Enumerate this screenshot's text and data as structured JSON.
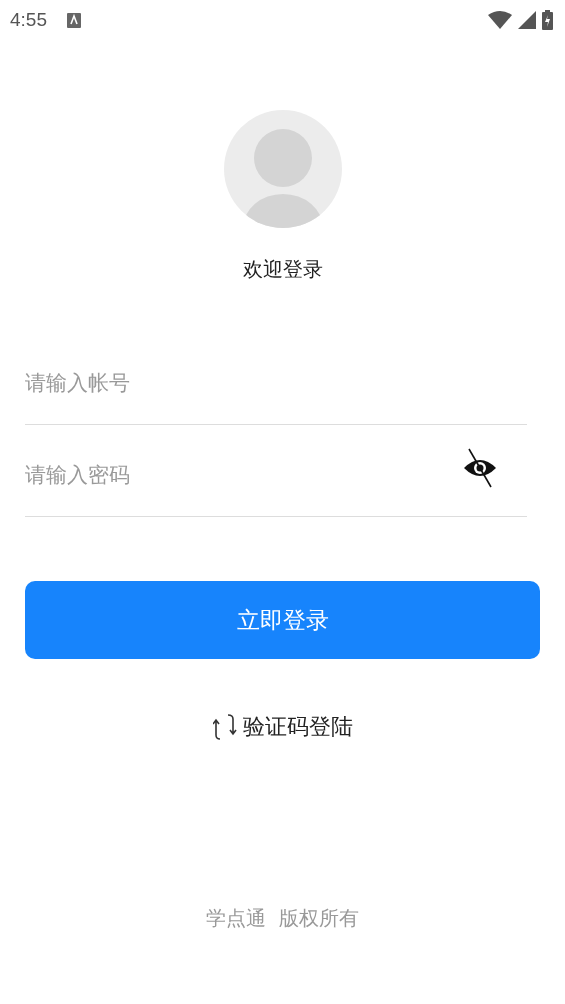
{
  "status_bar": {
    "time": "4:55"
  },
  "welcome": "欢迎登录",
  "account_field": {
    "placeholder": "请输入帐号"
  },
  "password_field": {
    "placeholder": "请输入密码",
    "password_hidden": true
  },
  "login_button": "立即登录",
  "switch_link": "验证码登陆",
  "footer": "学点通  版权所有"
}
